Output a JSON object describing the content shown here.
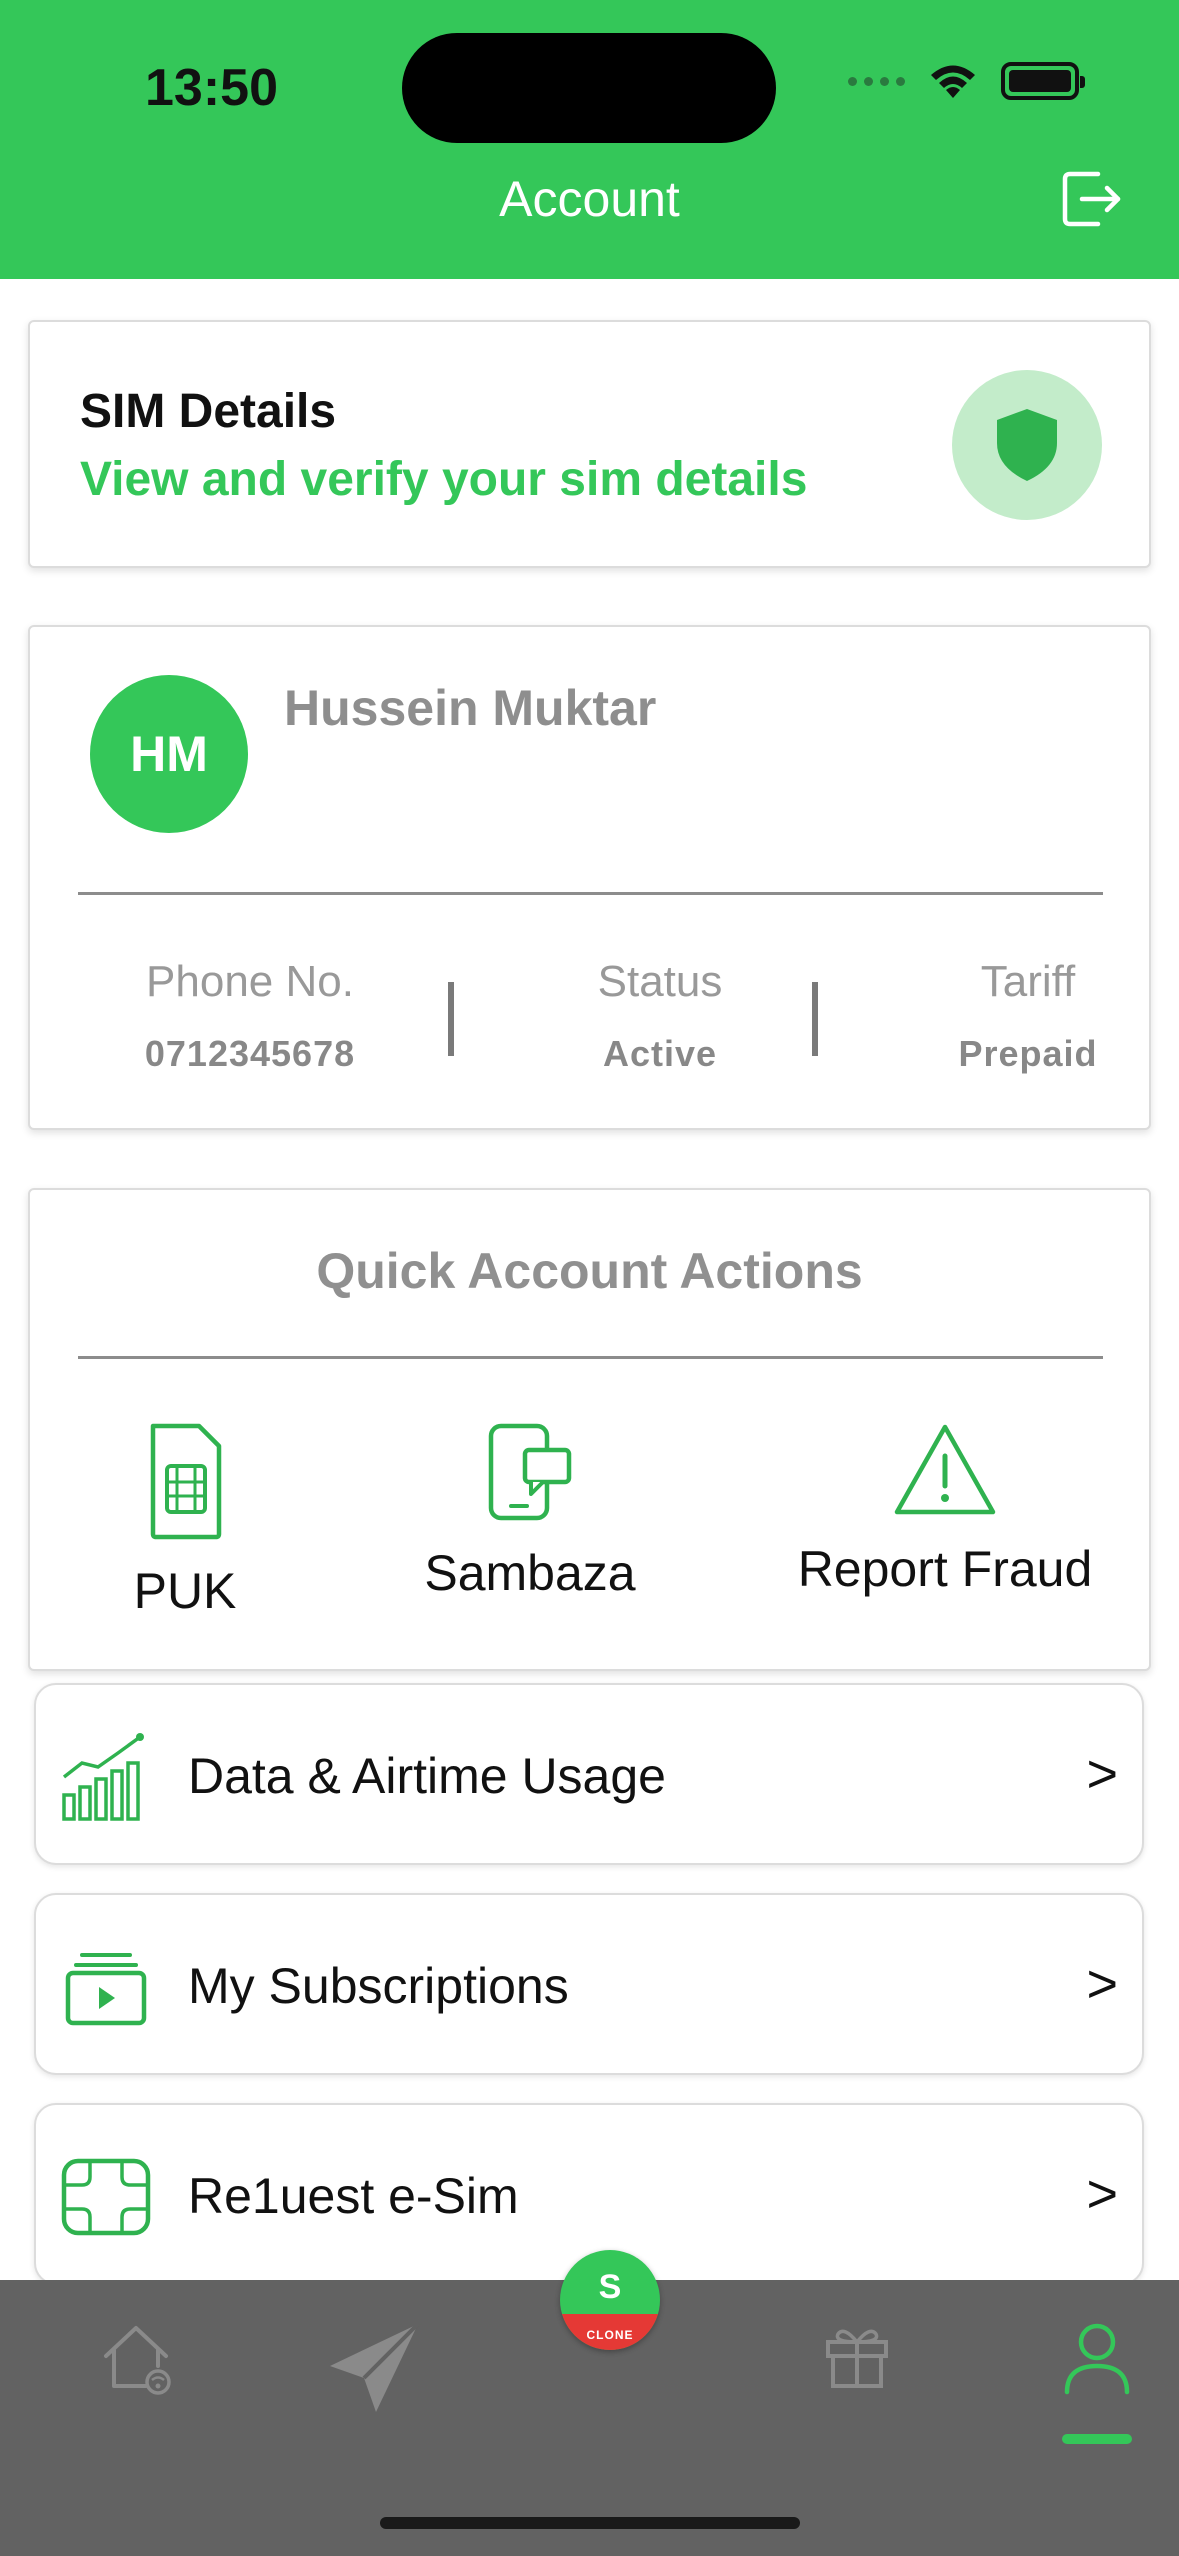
{
  "status_bar": {
    "time": "13:50"
  },
  "header": {
    "title": "Account"
  },
  "sim_card": {
    "title": "SIM Details",
    "subtitle": "View and verify your sim details"
  },
  "profile": {
    "initials": "HM",
    "name": "Hussein Muktar",
    "phone_label": "Phone No.",
    "phone_value": "0712345678",
    "status_label": "Status",
    "status_value": "Active",
    "tariff_label": "Tariff",
    "tariff_value": "Prepaid"
  },
  "quick_actions": {
    "title": "Quick Account Actions",
    "items": [
      {
        "label": "PUK",
        "icon": "sim-card-icon"
      },
      {
        "label": "Sambaza",
        "icon": "phone-share-icon"
      },
      {
        "label": "Report Fraud",
        "icon": "warning-icon"
      }
    ]
  },
  "menu_list": [
    {
      "label": "Data & Airtime Usage",
      "icon": "chart-icon",
      "chevron": ">"
    },
    {
      "label": "My Subscriptions",
      "icon": "subscriptions-icon",
      "chevron": ">"
    },
    {
      "label": "Re1uest e-Sim",
      "icon": "esim-icon",
      "chevron": ">"
    }
  ],
  "tab_bar": {
    "center_logo": {
      "letter": "S",
      "caption": "CLONE"
    },
    "active_tab": "account"
  },
  "colors": {
    "brand_green": "#34c759",
    "tab_bar_bg": "#626262",
    "accent_red": "#e53935"
  }
}
